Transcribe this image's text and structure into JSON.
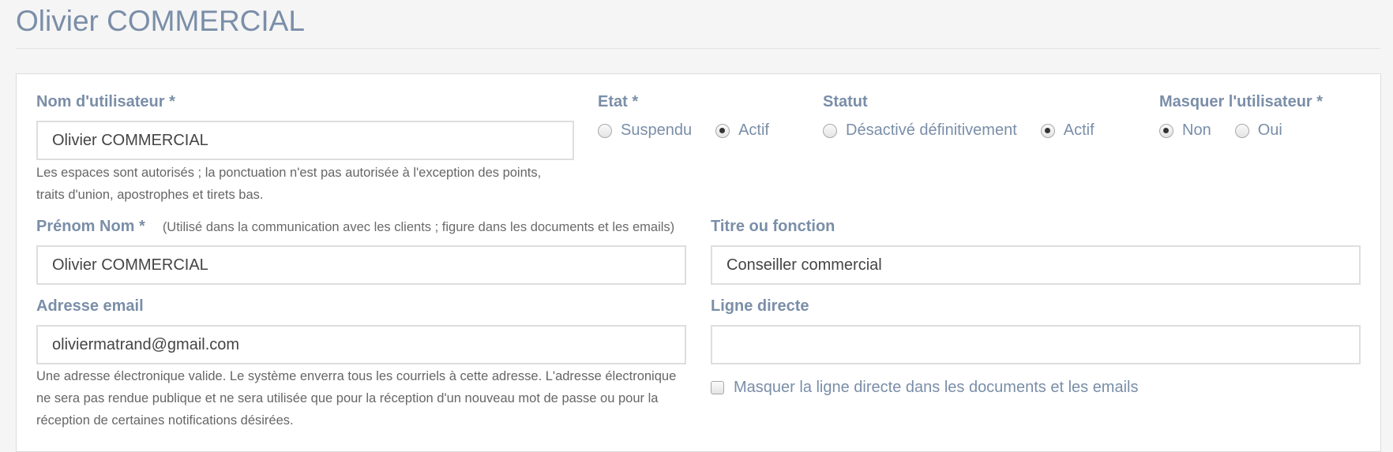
{
  "page_title": "Olivier COMMERCIAL",
  "username": {
    "label": "Nom d'utilisateur *",
    "value": "Olivier COMMERCIAL",
    "help_line1": "Les espaces sont autorisés ; la ponctuation n'est pas autorisée à l'exception des points,",
    "help_line2": "traits d'union, apostrophes et tirets bas."
  },
  "etat": {
    "label": "Etat *",
    "options": [
      {
        "label": "Suspendu",
        "checked": false
      },
      {
        "label": "Actif",
        "checked": true
      }
    ]
  },
  "statut": {
    "label": "Statut",
    "options": [
      {
        "label": "Désactivé définitivement",
        "checked": false
      },
      {
        "label": "Actif",
        "checked": true
      }
    ]
  },
  "masquer": {
    "label": "Masquer l'utilisateur *",
    "options": [
      {
        "label": "Non",
        "checked": true
      },
      {
        "label": "Oui",
        "checked": false
      }
    ]
  },
  "prenom_nom": {
    "label": "Prénom Nom *",
    "hint": "(Utilisé dans la communication avec les clients ; figure dans les documents et les emails)",
    "value": "Olivier COMMERCIAL"
  },
  "titre": {
    "label": "Titre ou fonction",
    "value": "Conseiller commercial"
  },
  "email": {
    "label": "Adresse email",
    "value": "oliviermatrand@gmail.com",
    "help_line1": "Une adresse électronique valide. Le système enverra tous les courriels à cette adresse. L'adresse électronique",
    "help_line2": "ne sera pas rendue publique et ne sera utilisée que pour la réception d'un nouveau mot de passe ou pour la",
    "help_line3": "réception de certaines notifications désirées."
  },
  "ligne_directe": {
    "label": "Ligne directe",
    "value": "",
    "checkbox_label": "Masquer la ligne directe dans les documents et les emails",
    "checkbox_checked": false
  }
}
